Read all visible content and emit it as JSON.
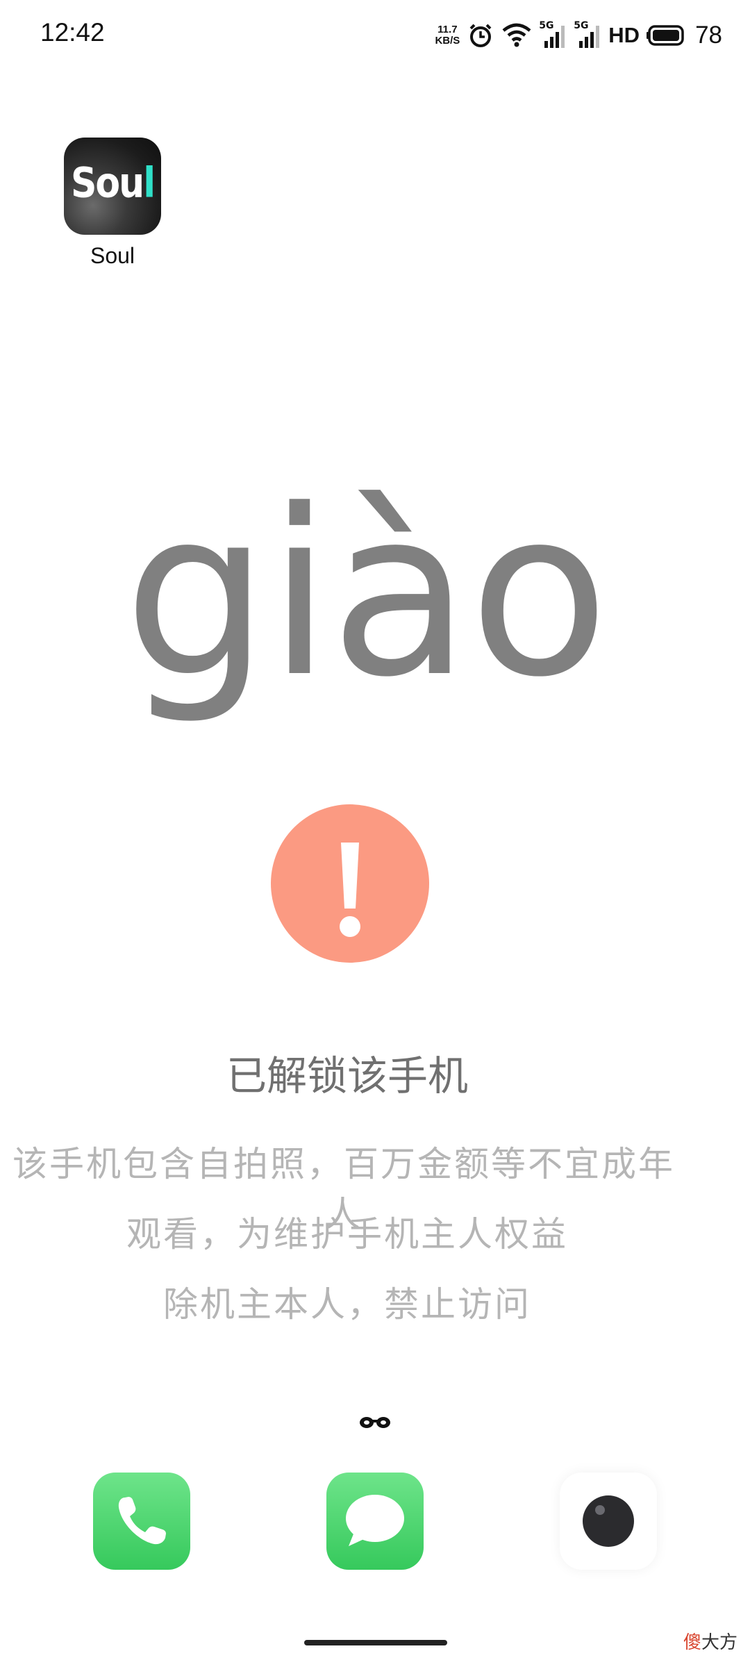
{
  "status_bar": {
    "time": "12:42",
    "net_speed_value": "11.7",
    "net_speed_unit": "KB/S",
    "sim1": "5G",
    "sim2": "5G",
    "hd": "HD",
    "battery": "78",
    "icons": [
      "alarm-icon",
      "wifi-icon",
      "signal-icon",
      "signal-icon",
      "battery-icon"
    ]
  },
  "home_app": {
    "label": "Soul",
    "logo_text_main": "Sou",
    "logo_text_accent": "l"
  },
  "prank_screen": {
    "big_text": "giào",
    "title": "已解锁该手机",
    "lines": [
      "该手机包含自拍照，百万金额等不宜成年人",
      "观看，为维护手机主人权益",
      "除机主本人，禁止访问"
    ],
    "warning_color": "#fb9a82"
  },
  "dock": {
    "apps": [
      "phone-icon",
      "messages-icon",
      "camera-icon"
    ]
  },
  "watermark": {
    "accent": "傻",
    "rest": "大方"
  }
}
